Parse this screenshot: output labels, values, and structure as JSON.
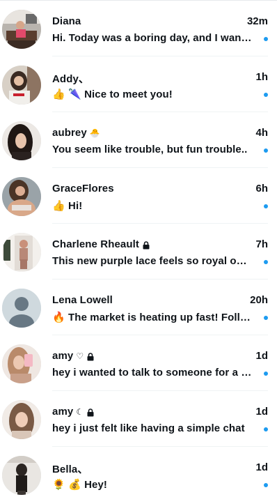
{
  "colors": {
    "unread_dot": "#1d9bf0",
    "text": "#0f1419",
    "divider": "#eff3f4"
  },
  "conversations": [
    {
      "name": "Diana",
      "badge_icon": "",
      "locked": false,
      "time": "32m",
      "preview": "Hi. Today was a boring day, and I wanted to chat",
      "unread": true
    },
    {
      "name": "Addy、",
      "badge_icon": "",
      "locked": false,
      "time": "1h",
      "preview": "👍 🌂 Nice to meet you!",
      "unread": true
    },
    {
      "name": "aubrey",
      "badge_icon": "🐣",
      "locked": false,
      "time": "4h",
      "preview": "You seem like trouble, but fun trouble..",
      "unread": true
    },
    {
      "name": "GraceFlores",
      "badge_icon": "",
      "locked": false,
      "time": "6h",
      "preview": "👍 Hi!",
      "unread": true
    },
    {
      "name": "Charlene Rheault",
      "badge_icon": "",
      "locked": true,
      "time": "7h",
      "preview": "This new purple lace feels so royal on me",
      "unread": true
    },
    {
      "name": "Lena Lowell",
      "badge_icon": "",
      "locked": false,
      "time": "20h",
      "preview": "🔥 The market is heating up fast! Follow",
      "unread": true
    },
    {
      "name": "amy",
      "badge_icon": "♡",
      "locked": true,
      "time": "1d",
      "preview": "hey i wanted to talk to someone for a bit",
      "unread": true
    },
    {
      "name": "amy",
      "badge_icon": "☾",
      "locked": true,
      "time": "1d",
      "preview": "hey i just felt like having a simple chat",
      "unread": true
    },
    {
      "name": "Bella、",
      "badge_icon": "",
      "locked": false,
      "time": "1d",
      "preview": "🌻 💰 Hey!",
      "unread": true
    }
  ]
}
